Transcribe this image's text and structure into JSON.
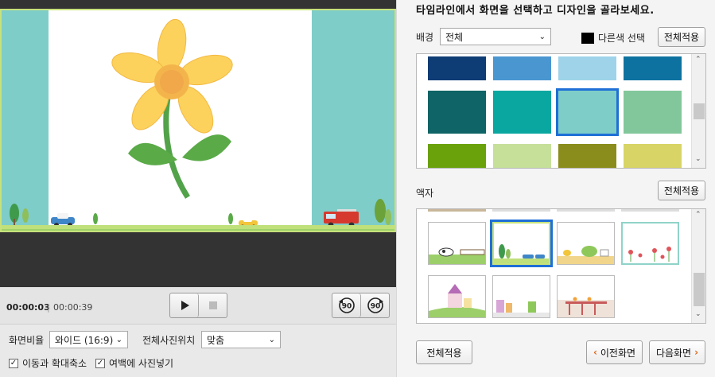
{
  "left": {
    "time_current": "00:00:03",
    "time_separator": "|",
    "time_total": "00:00:39",
    "aspect_label": "화면비율",
    "aspect_value": "와이드 (16:9)",
    "photo_pos_label": "전체사진위치",
    "photo_pos_value": "맞춤",
    "move_zoom_label": "이동과 확대축소",
    "move_zoom_checked": true,
    "margin_fill_label": "여백에 사진넣기",
    "margin_fill_checked": true,
    "rotate_left_label": "90",
    "rotate_right_label": "90"
  },
  "right": {
    "instruction": "타임라인에서 화면을 선택하고 디자인을 골라보세요.",
    "bg_label": "배경",
    "bg_value": "전체",
    "other_color_label": "다른색 선택",
    "apply_all_bg": "전체적용",
    "frame_label": "액자",
    "apply_all_frame": "전체적용",
    "apply_all_bottom": "전체적용",
    "prev_label": "이전화면",
    "next_label": "다음화면",
    "colors": {
      "row1": [
        "#0e3c74",
        "#4a96d1",
        "#9ed3ea",
        "#0e72a0"
      ],
      "row2": [
        "#0e6466",
        "#0aa7a0",
        "#7fcdc8",
        "#82c79b"
      ],
      "row3": [
        "#6aa20c",
        "#c6e09a",
        "#8a8d1c",
        "#d8d466"
      ],
      "selected_color": "#7fcdc8",
      "selection_border": "#1e6fd6"
    }
  }
}
